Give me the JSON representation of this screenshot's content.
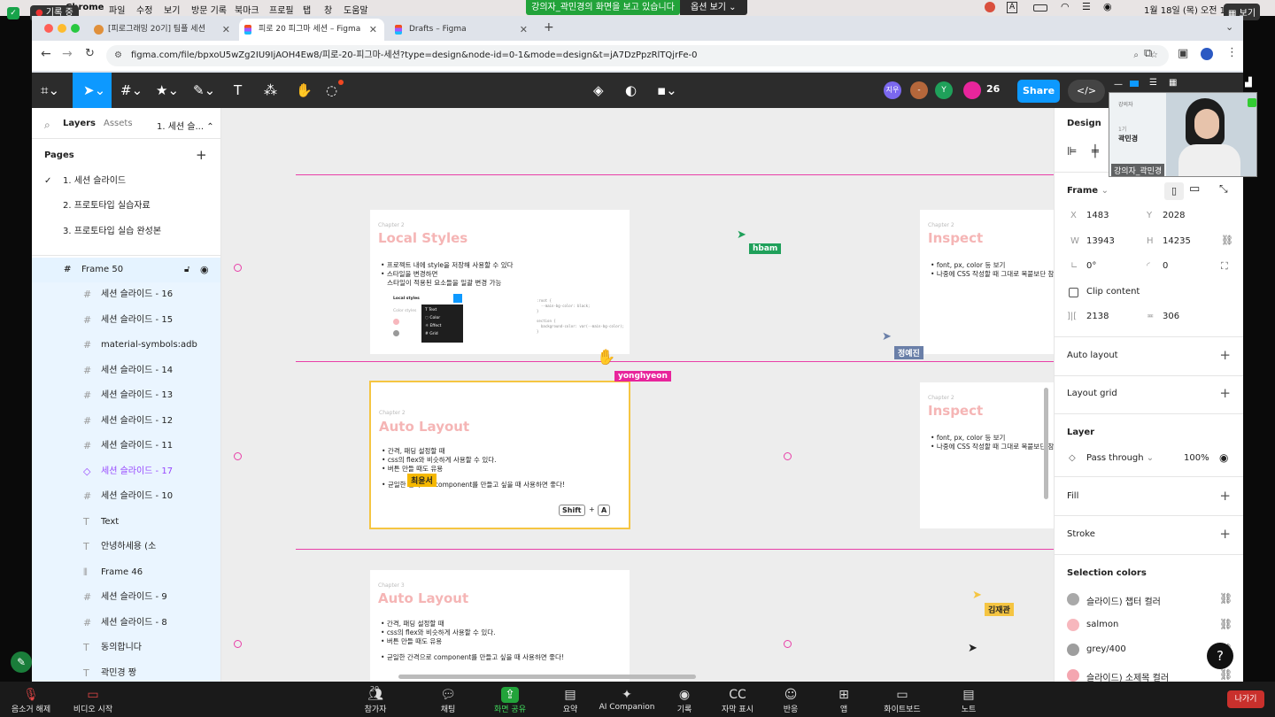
{
  "mac_menu": {
    "app": "Chrome",
    "items": [
      "파일",
      "수정",
      "보기",
      "방문 기록",
      "북마크",
      "프로필",
      "탭",
      "창",
      "도움말"
    ],
    "record_badge": "기록 중",
    "datetime": "1월 18일 (목) 오전 10:19",
    "view_label": "보기"
  },
  "zoom_share": {
    "banner": "강의자_곽민경의 화면을 보고 있습니다",
    "options": "옵션 보기"
  },
  "browser": {
    "tabs": [
      {
        "title": "[피로그래밍 20기] 팀플 세션"
      },
      {
        "title": "피로 20 피그마 세션 – Figma"
      },
      {
        "title": "Drafts – Figma"
      }
    ],
    "url": "figma.com/file/bpxoU5wZg2IU9IjAOH4Ew8/피로-20-피그마-세션?type=design&node-id=0-1&mode=design&t=jA7DzPpzRlTQjrFe-0"
  },
  "figma_toolbar": {
    "avatars": [
      "지우",
      "-",
      "Y"
    ],
    "count": "26",
    "share": "Share",
    "colors": {
      "share": "#0d99ff",
      "toolbar": "#2c2c2c",
      "select": "#0d99ff"
    }
  },
  "left_panel": {
    "tabs": [
      "Layers",
      "Assets"
    ],
    "page_selector": "1. 세션 슬...",
    "pages_heading": "Pages",
    "pages": [
      "1. 세션 슬라이드",
      "2. 프로토타입 실습자료",
      "3. 프로토타입 실습 완성본"
    ],
    "selected_frame": "Frame 50",
    "layers": [
      {
        "icon": "frame",
        "label": "세션 슬라이드 - 16"
      },
      {
        "icon": "frame",
        "label": "세션 슬라이드 - 15"
      },
      {
        "icon": "frame",
        "label": "material-symbols:adb"
      },
      {
        "icon": "frame",
        "label": "세션 슬라이드 - 14"
      },
      {
        "icon": "frame",
        "label": "세션 슬라이드 - 13"
      },
      {
        "icon": "frame",
        "label": "세션 슬라이드 - 12"
      },
      {
        "icon": "frame",
        "label": "세션 슬라이드 - 11"
      },
      {
        "icon": "component",
        "label": "세션 슬라이드 - 17"
      },
      {
        "icon": "frame",
        "label": "세션 슬라이드 - 10"
      },
      {
        "icon": "text",
        "label": "Text"
      },
      {
        "icon": "text",
        "label": "안녕하세용 (소"
      },
      {
        "icon": "autolayout",
        "label": "Frame 46"
      },
      {
        "icon": "frame",
        "label": "세션 슬라이드 - 9"
      },
      {
        "icon": "frame",
        "label": "세션 슬라이드 - 8"
      },
      {
        "icon": "text",
        "label": "동의합니다"
      },
      {
        "icon": "text",
        "label": "곽민경 짱"
      }
    ]
  },
  "canvas": {
    "slides": [
      {
        "chapter": "Chapter 2",
        "title": "Local Styles",
        "bullets": [
          "프로젝트 내에 style을 저장해 사용할 수 있다",
          "스타일을 변경하면",
          "스타일이 적용된 요소들을 일괄 변경 가능"
        ],
        "menu": [
          "Text",
          "Color",
          "Effect",
          "Grid"
        ],
        "menu_head": "Local styles",
        "sub_head": "Color styles",
        "code": [
          ":root {",
          "--main-bg-color: black;",
          "}",
          "section {",
          "background-color: var(--main-bg-color);",
          "}"
        ]
      },
      {
        "chapter": "Chapter 2",
        "title": "Inspect",
        "bullets": [
          "font, px, color 등 보기",
          "나중에 CSS 작성할 때 그대로 복붙보단 참"
        ]
      },
      {
        "chapter": "Chapter 2",
        "title": "Auto Layout",
        "bullets": [
          "간격, 패딩 설정할 때",
          "css의 flex와 비슷하게 사용할 수 있다.",
          "버튼 만들 때도 유용",
          "균일한 간격으로 component를 만들고 싶을 때 사용하면 좋다!"
        ],
        "kbd": [
          "Shift",
          "+",
          "A"
        ]
      },
      {
        "chapter": "Chapter 2",
        "title": "Inspect",
        "bullets": [
          "font, px, color 등 보기",
          "나중에 CSS 작성할 때 그대로 복붙보단 참"
        ]
      },
      {
        "chapter": "Chapter 3",
        "title": "Auto Layout",
        "bullets": [
          "간격, 패딩 설정할 때",
          "css의 flex와 비슷하게 사용할 수 있다.",
          "버튼 만들 때도 유용",
          "균일한 간격으로 component를 만들고 싶을 때 사용하면 좋다!"
        ]
      }
    ],
    "cursors": [
      {
        "name": "hbam",
        "color": "#1fa05a"
      },
      {
        "name": "정예진",
        "color": "#6a7fa8"
      },
      {
        "name": "yonghyeon",
        "color": "#e8259c"
      },
      {
        "name": "최윤서",
        "color": "#f5b800"
      },
      {
        "name": "김재관",
        "color": "#f5c542"
      }
    ]
  },
  "right_panel": {
    "tab": "Design",
    "frame_label": "Frame",
    "x": "1483",
    "y": "2028",
    "w": "13943",
    "h": "14235",
    "rotation": "0°",
    "radius": "0",
    "clip_content": "Clip content",
    "gap_h": "2138",
    "gap_v": "306",
    "sections": [
      "Auto layout",
      "Layout grid"
    ],
    "layer": {
      "heading": "Layer",
      "blend": "Pass through",
      "opacity": "100%"
    },
    "fill": "Fill",
    "stroke": "Stroke",
    "selection_colors": {
      "heading": "Selection colors",
      "items": [
        {
          "name": "슬라이드) 챕터 컬러",
          "color": "#a9a9a9"
        },
        {
          "name": "salmon",
          "color": "#f7b7bd"
        },
        {
          "name": "grey/400",
          "color": "#9e9e9e"
        },
        {
          "name": "슬라이드) 소제목 컬러",
          "color": "#f4a6b0"
        }
      ]
    }
  },
  "webcam": {
    "top_label": "강의자",
    "cohort": "1기",
    "person": "곽민경",
    "caption": "강의자_곽민경"
  },
  "zoom_bar": {
    "items": [
      {
        "label": "음소거 해제",
        "icon": "mic-off"
      },
      {
        "label": "비디오 시작",
        "icon": "video-off"
      },
      {
        "label": "참가자",
        "icon": "participants",
        "count": "29"
      },
      {
        "label": "채팅",
        "icon": "chat"
      },
      {
        "label": "화면 공유",
        "icon": "share-screen"
      },
      {
        "label": "요약",
        "icon": "summary"
      },
      {
        "label": "AI Companion",
        "icon": "sparkle"
      },
      {
        "label": "기록",
        "icon": "record"
      },
      {
        "label": "자막 표시",
        "icon": "cc"
      },
      {
        "label": "반응",
        "icon": "reaction"
      },
      {
        "label": "앱",
        "icon": "apps"
      },
      {
        "label": "화이트보드",
        "icon": "whiteboard"
      },
      {
        "label": "노트",
        "icon": "notes"
      }
    ],
    "leave": "나가기"
  }
}
